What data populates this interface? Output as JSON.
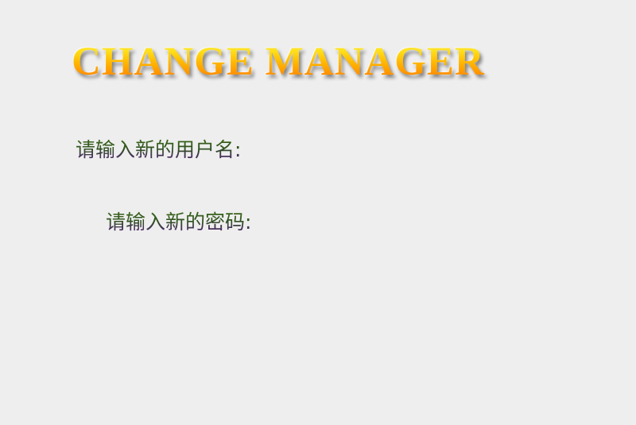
{
  "header": {
    "title": "CHANGE MANAGER"
  },
  "form": {
    "username_label": "请输入新的用户名:",
    "password_label": "请输入新的密码:"
  },
  "colors": {
    "background": "#eeeeee",
    "title_gradient_top": "#fff27a",
    "title_gradient_bottom": "#f05a00",
    "label_green": "#2f5220",
    "label_purple": "#4a2f5e"
  }
}
